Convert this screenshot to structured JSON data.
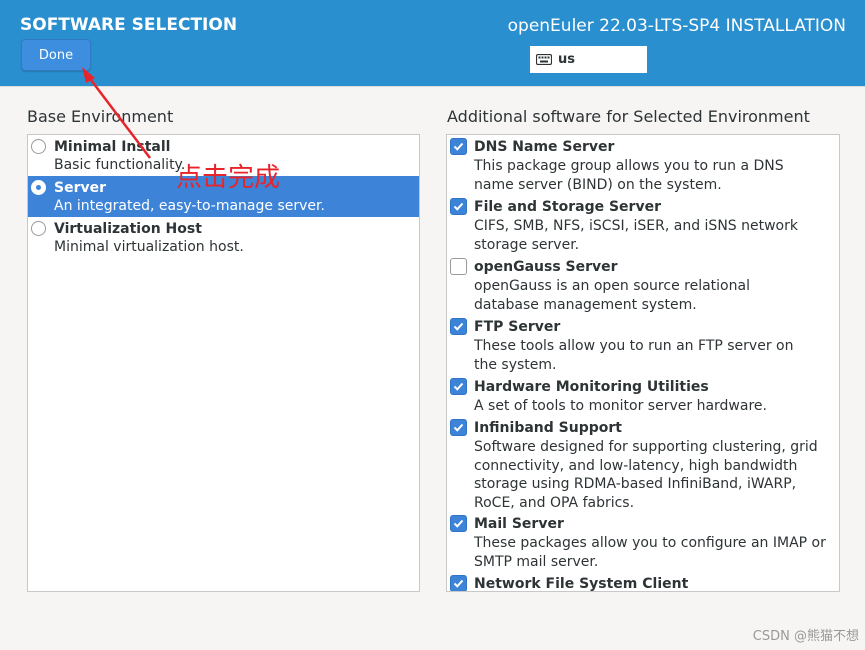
{
  "header": {
    "title": "SOFTWARE SELECTION",
    "product": "openEuler 22.03-LTS-SP4 INSTALLATION",
    "done_label": "Done",
    "keyboard_layout": "us",
    "background_color": "#2a8fce"
  },
  "base_environment": {
    "label": "Base Environment",
    "items": [
      {
        "name": "Minimal Install",
        "desc": "Basic functionality.",
        "selected": false
      },
      {
        "name": "Server",
        "desc": "An integrated, easy-to-manage server.",
        "selected": true
      },
      {
        "name": "Virtualization Host",
        "desc": "Minimal virtualization host.",
        "selected": false
      }
    ]
  },
  "additional_software": {
    "label": "Additional software for Selected Environment",
    "items": [
      {
        "name": "DNS Name Server",
        "desc": "This package group allows you to run a DNS name server (BIND) on the system.",
        "checked": true
      },
      {
        "name": "File and Storage Server",
        "desc": "CIFS, SMB, NFS, iSCSI, iSER, and iSNS network storage server.",
        "checked": true
      },
      {
        "name": "openGauss Server",
        "desc": "openGauss is an open source relational database management system.",
        "checked": false
      },
      {
        "name": "FTP Server",
        "desc": "These tools allow you to run an FTP server on the system.",
        "checked": true
      },
      {
        "name": "Hardware Monitoring Utilities",
        "desc": "A set of tools to monitor server hardware.",
        "checked": true
      },
      {
        "name": "Infiniband Support",
        "desc": "Software designed for supporting clustering, grid connectivity, and low-latency, high bandwidth storage using RDMA-based InfiniBand, iWARP, RoCE, and OPA fabrics.",
        "checked": true
      },
      {
        "name": "Mail Server",
        "desc": "These packages allow you to configure an IMAP or SMTP mail server.",
        "checked": true
      },
      {
        "name": "Network File System Client",
        "desc": "",
        "checked": true
      }
    ]
  },
  "annotation": {
    "text": "点击完成",
    "color": "#e8242b"
  },
  "watermark": "CSDN @熊猫不想",
  "accent_color": "#3d84d9"
}
